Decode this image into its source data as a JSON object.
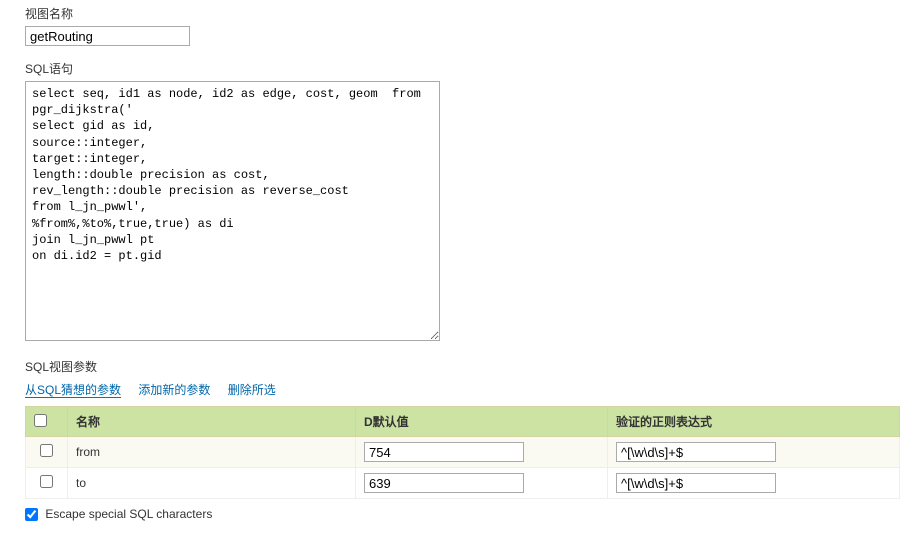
{
  "labels": {
    "view_name": "视图名称",
    "sql_stmt": "SQL语句",
    "sql_params": "SQL视图参数"
  },
  "values": {
    "view_name": "getRouting",
    "sql": "select seq, id1 as node, id2 as edge, cost, geom  from\npgr_dijkstra('\nselect gid as id,\nsource::integer,\ntarget::integer,\nlength::double precision as cost,\nrev_length::double precision as reverse_cost\nfrom l_jn_pwwl',\n%from%,%to%,true,true) as di\njoin l_jn_pwwl pt\non di.id2 = pt.gid\n"
  },
  "links": {
    "guess": "从SQL猜想的参数",
    "add": "添加新的参数",
    "remove": "删除所选"
  },
  "table": {
    "headers": {
      "name": "名称",
      "default": "D默认值",
      "regex": "验证的正则表达式"
    },
    "rows": [
      {
        "name": "from",
        "default": "754",
        "regex": "^[\\w\\d\\s]+$"
      },
      {
        "name": "to",
        "default": "639",
        "regex": "^[\\w\\d\\s]+$"
      }
    ]
  },
  "escape_label": "Escape special SQL characters",
  "escape_checked": true
}
